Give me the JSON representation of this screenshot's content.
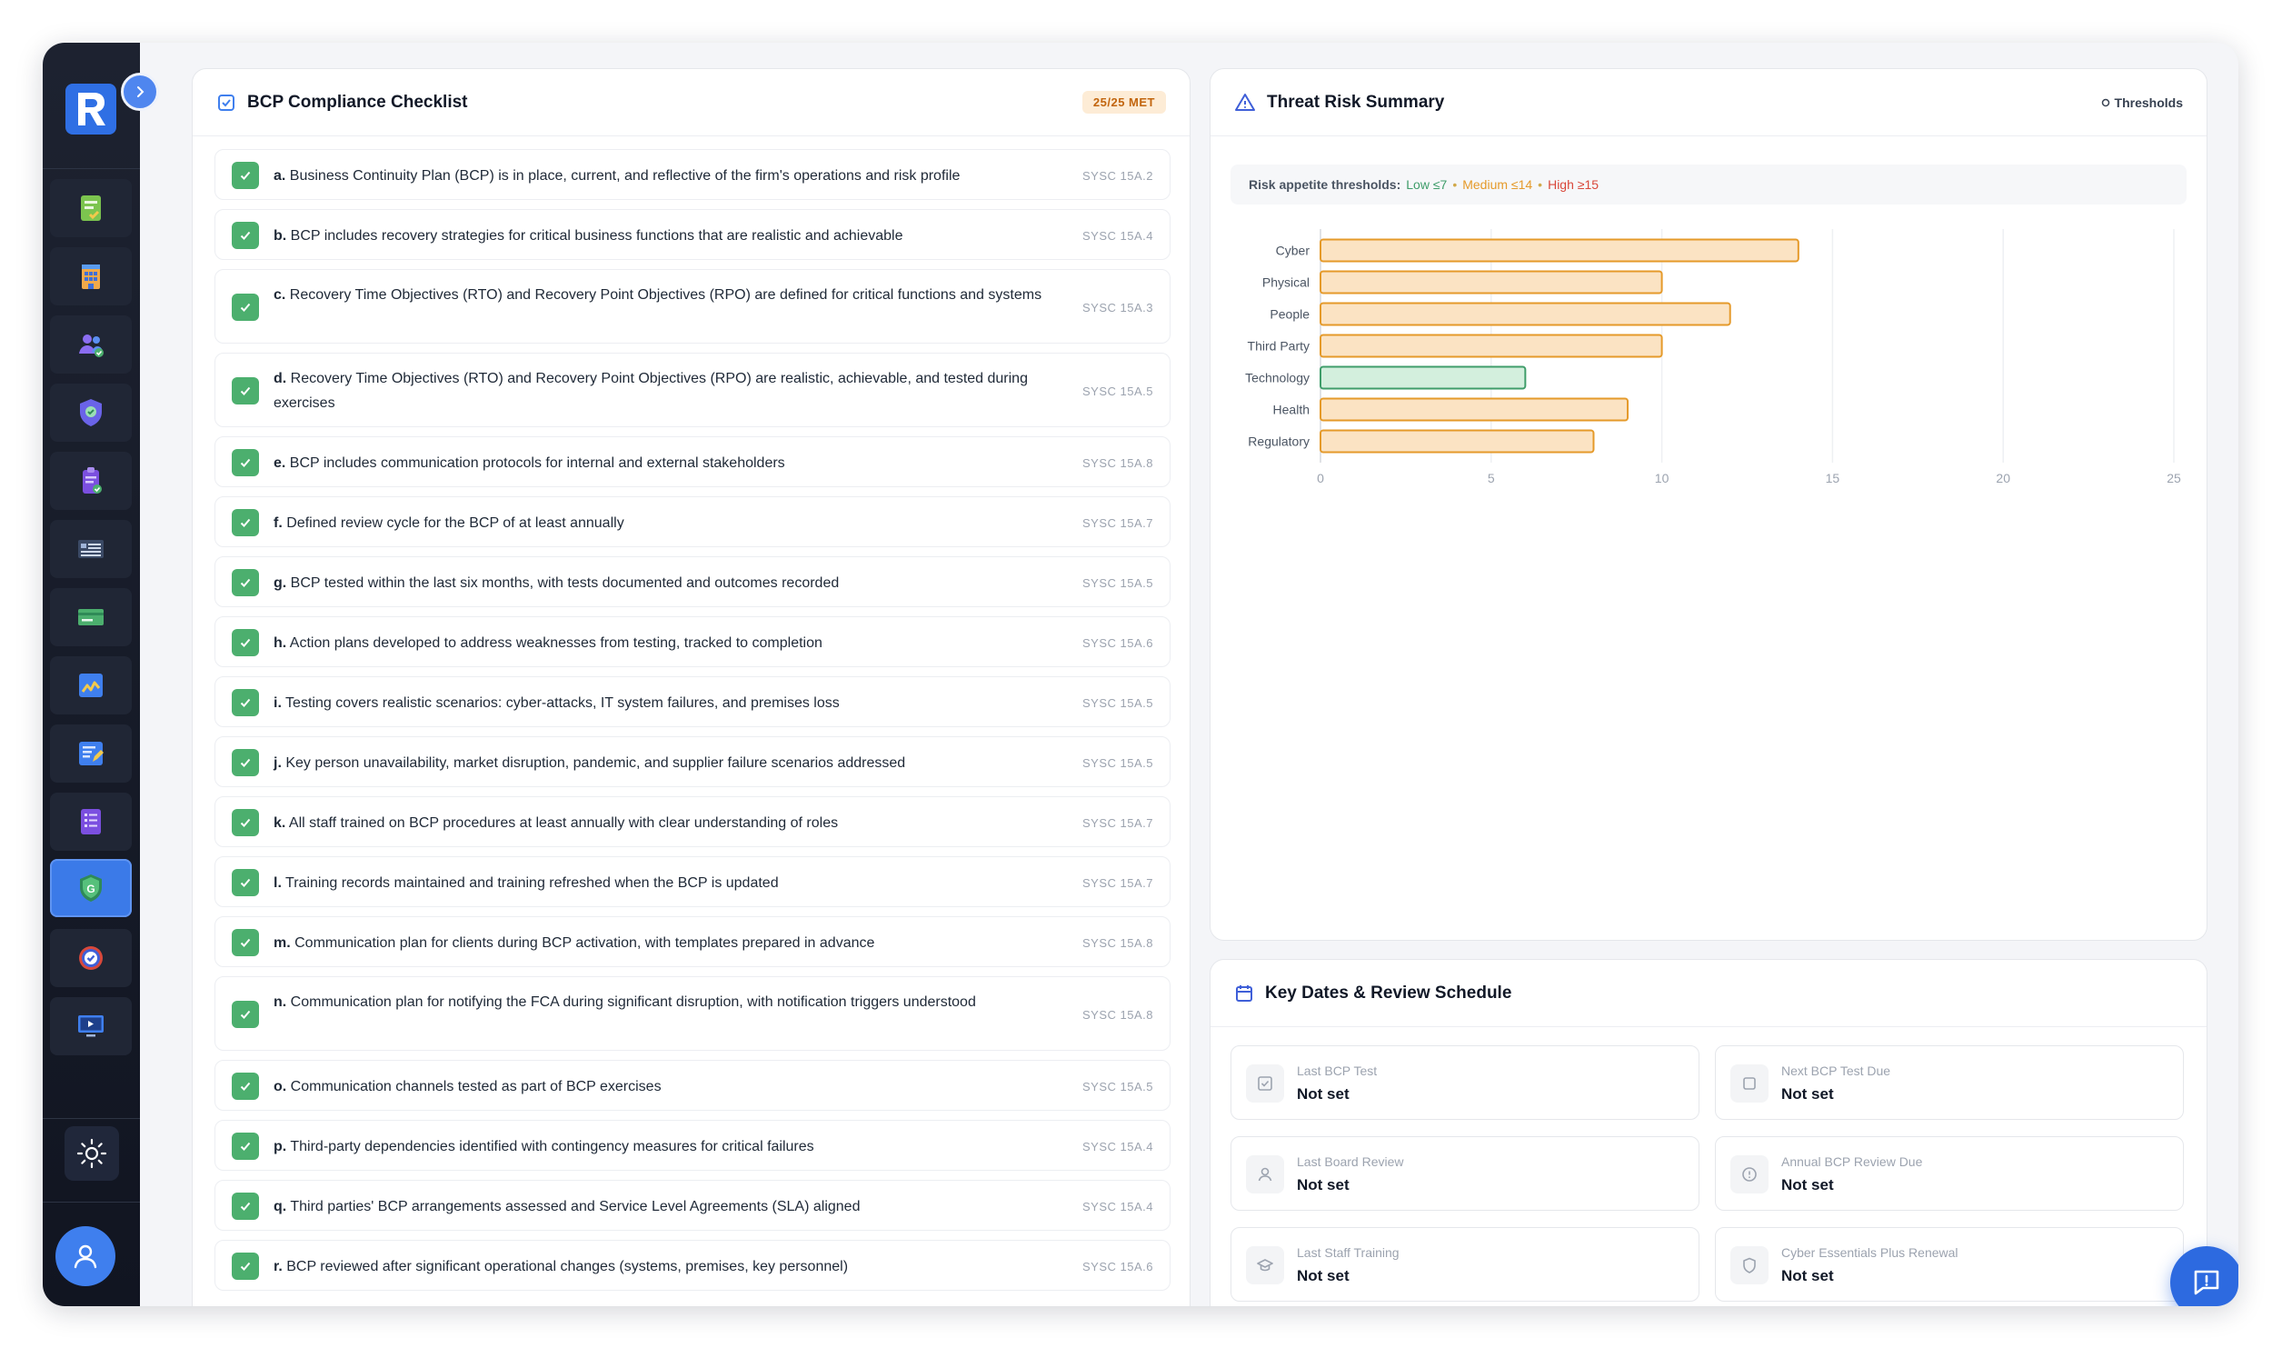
{
  "checklist": {
    "title": "BCP Compliance Checklist",
    "badge": "25/25 MET",
    "items": [
      {
        "key": "a.",
        "text": "Business Continuity Plan (BCP) is in place, current, and reflective of the firm's operations and risk profile",
        "ref": "SYSC 15A.2"
      },
      {
        "key": "b.",
        "text": "BCP includes recovery strategies for critical business functions that are realistic and achievable",
        "ref": "SYSC 15A.4"
      },
      {
        "key": "c.",
        "text": "Recovery Time Objectives (RTO) and Recovery Point Objectives (RPO) are defined for critical functions and systems",
        "ref": "SYSC 15A.3"
      },
      {
        "key": "d.",
        "text": "Recovery Time Objectives (RTO) and Recovery Point Objectives (RPO) are realistic, achievable, and tested during exercises",
        "ref": "SYSC 15A.5"
      },
      {
        "key": "e.",
        "text": "BCP includes communication protocols for internal and external stakeholders",
        "ref": "SYSC 15A.8"
      },
      {
        "key": "f.",
        "text": "Defined review cycle for the BCP of at least annually",
        "ref": "SYSC 15A.7"
      },
      {
        "key": "g.",
        "text": "BCP tested within the last six months, with tests documented and outcomes recorded",
        "ref": "SYSC 15A.5"
      },
      {
        "key": "h.",
        "text": "Action plans developed to address weaknesses from testing, tracked to completion",
        "ref": "SYSC 15A.6"
      },
      {
        "key": "i.",
        "text": "Testing covers realistic scenarios: cyber-attacks, IT system failures, and premises loss",
        "ref": "SYSC 15A.5"
      },
      {
        "key": "j.",
        "text": "Key person unavailability, market disruption, pandemic, and supplier failure scenarios addressed",
        "ref": "SYSC 15A.5"
      },
      {
        "key": "k.",
        "text": "All staff trained on BCP procedures at least annually with clear understanding of roles",
        "ref": "SYSC 15A.7"
      },
      {
        "key": "l.",
        "text": "Training records maintained and training refreshed when the BCP is updated",
        "ref": "SYSC 15A.7"
      },
      {
        "key": "m.",
        "text": "Communication plan for clients during BCP activation, with templates prepared in advance",
        "ref": "SYSC 15A.8"
      },
      {
        "key": "n.",
        "text": "Communication plan for notifying the FCA during significant disruption, with notification triggers understood",
        "ref": "SYSC 15A.8"
      },
      {
        "key": "o.",
        "text": "Communication channels tested as part of BCP exercises",
        "ref": "SYSC 15A.5"
      },
      {
        "key": "p.",
        "text": "Third-party dependencies identified with contingency measures for critical failures",
        "ref": "SYSC 15A.4"
      },
      {
        "key": "q.",
        "text": "Third parties' BCP arrangements assessed and Service Level Agreements (SLA) aligned",
        "ref": "SYSC 15A.4"
      },
      {
        "key": "r.",
        "text": "BCP reviewed after significant operational changes (systems, premises, key personnel)",
        "ref": "SYSC 15A.6"
      }
    ]
  },
  "threat": {
    "title": "Threat Risk Summary",
    "thresholds_button": "Thresholds",
    "thresholds_label": "Risk appetite thresholds:",
    "low": "Low ≤7",
    "medium": "Medium ≤14",
    "high": "High ≥15",
    "sep": "•"
  },
  "colors": {
    "low": "#3f9d6a",
    "medium": "#e59a2a",
    "high": "#d9483b",
    "accent": "#2d6ae0"
  },
  "chart_data": {
    "type": "bar",
    "orientation": "horizontal",
    "categories": [
      "Cyber",
      "Physical",
      "People",
      "Third Party",
      "Technology",
      "Health",
      "Regulatory"
    ],
    "values": [
      14,
      10,
      12,
      10,
      6,
      9,
      8
    ],
    "xlim": [
      0,
      25
    ],
    "xticks": [
      "0",
      "5",
      "10",
      "15",
      "20",
      "25"
    ],
    "grid": true
  },
  "dates": {
    "title": "Key Dates & Review Schedule",
    "items": [
      {
        "label": "Last BCP Test",
        "value": "Not set",
        "icon": "checkbox-icon"
      },
      {
        "label": "Next BCP Test Due",
        "value": "Not set",
        "icon": "square-icon"
      },
      {
        "label": "Last Board Review",
        "value": "Not set",
        "icon": "user-icon"
      },
      {
        "label": "Annual BCP Review Due",
        "value": "Not set",
        "icon": "alert-circle-icon"
      },
      {
        "label": "Last Staff Training",
        "value": "Not set",
        "icon": "graduation-cap-icon"
      },
      {
        "label": "Cyber Essentials Plus Renewal",
        "value": "Not set",
        "icon": "shield-icon"
      }
    ]
  }
}
